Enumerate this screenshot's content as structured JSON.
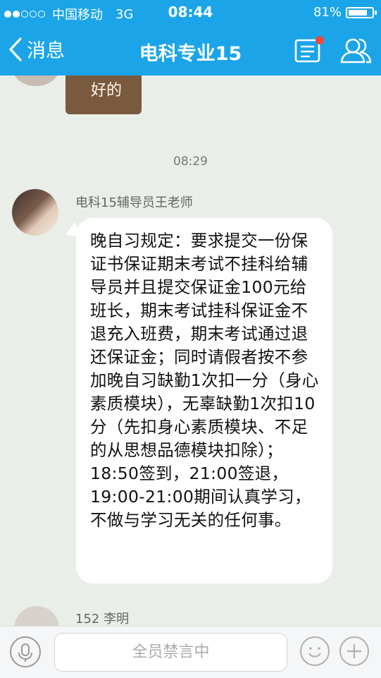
{
  "status_bar": {
    "carrier": "中国移动",
    "network": "3G",
    "time": "08:44",
    "battery": "81%",
    "battery_level": 0.81
  },
  "nav": {
    "back_label": "消息",
    "title": "电科专业15"
  },
  "chat": {
    "sticker_text": "好的",
    "time_separator": "08:29",
    "messages": [
      {
        "sender": "电科15辅导员王老师",
        "text": "晚自习规定：要求提交一份保证书保证期末考试不挂科给辅导员并且提交保证金100元给班长，期末考试挂科保证金不退充入班费，期末考试通过退还保证金；同时请假者按不参加晚自习缺勤1次扣一分（身心素质模块），无辜缺勤1次扣10分（先扣身心素质模块、不足的从思想品德模块扣除）；18:50签到，21:00签退，19:00-21:00期间认真学习，不做与学习无关的任何事。"
      },
      {
        "sender": "152 李明"
      }
    ]
  },
  "input": {
    "placeholder": "全员禁言中"
  },
  "colors": {
    "accent": "#1ba5e8",
    "chat_background": "#e9efe8",
    "notification_dot": "#f0483e"
  }
}
